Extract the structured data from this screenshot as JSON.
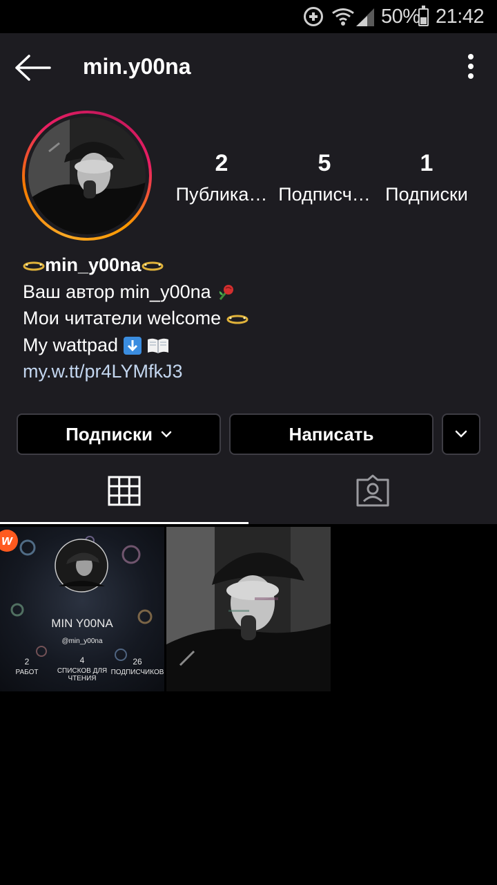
{
  "status_bar": {
    "battery_percent": "50%",
    "time": "21:42",
    "battery_level": 0.5
  },
  "header": {
    "username": "min.y00na"
  },
  "profile": {
    "stats": [
      {
        "value": "2",
        "label": "Публика…"
      },
      {
        "value": "5",
        "label": "Подписч…"
      },
      {
        "value": "1",
        "label": "Подписки"
      }
    ],
    "bio": {
      "name": "min_y00na",
      "line1": "Ваш автор min_y00na",
      "line2": "Мои читатели welcome",
      "line3": "My wattpad",
      "link": "my.w.tt/pr4LYMfkJ3"
    }
  },
  "actions": {
    "following_label": "Подписки",
    "message_label": "Написать"
  },
  "posts": {
    "wattpad_card": {
      "logo": "w",
      "name": "MIN Y00NA",
      "handle": "@min_y00na",
      "stats": [
        {
          "value": "2",
          "label": "РАБОТ"
        },
        {
          "value": "4",
          "label": "СПИСКОВ ДЛЯ ЧТЕНИЯ"
        },
        {
          "value": "26",
          "label": "ПОДПИСЧИКОВ"
        }
      ]
    }
  },
  "icons": {
    "back": "back-arrow-icon",
    "more": "more-vertical-icon",
    "grid_tab": "grid-icon",
    "tagged_tab": "tagged-person-icon"
  },
  "colors": {
    "background": "#1d1c21",
    "link": "#c3d6ef",
    "ring_start": "#f9a825",
    "ring_end": "#e91e63"
  }
}
